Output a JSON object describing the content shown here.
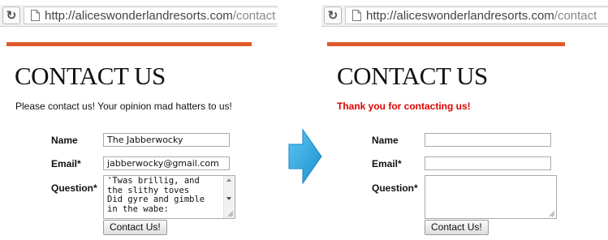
{
  "browser": {
    "url_host": "http://aliceswonderlandresorts.com",
    "url_path": "/contact"
  },
  "before": {
    "page_title": "CONTACT US",
    "intro_text": "Please contact us! Your opinion mad hatters to us!",
    "form": {
      "name_label": "Name",
      "email_label": "Email*",
      "question_label": "Question*",
      "name_value": "The Jabberwocky",
      "email_value": "jabberwocky@gmail.com",
      "question_value": "'Twas brillig, and\nthe slithy toves\nDid gyre and gimble\nin the wabe:",
      "submit_label": "Contact Us!"
    }
  },
  "after": {
    "page_title": "CONTACT US",
    "confirmation_text": "Thank you for contacting us!",
    "form": {
      "name_label": "Name",
      "email_label": "Email*",
      "question_label": "Question*",
      "name_value": "",
      "email_value": "",
      "question_value": "",
      "submit_label": "Contact Us!"
    }
  },
  "colors": {
    "accent_bar": "#e05a2b",
    "confirmation": "#e00000",
    "arrow": "#2aa6e0"
  },
  "icons": [
    "reload-icon",
    "page-icon",
    "right-arrow-icon",
    "scroll-up-icon",
    "scroll-down-icon",
    "resize-grip-icon"
  ]
}
